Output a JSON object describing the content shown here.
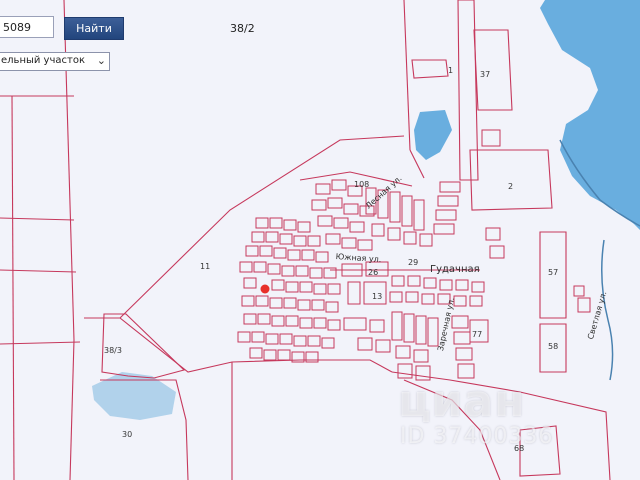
{
  "toolbar": {
    "search_value": "5089",
    "find_label": "Найти",
    "type_select_value": "ельный участок"
  },
  "map": {
    "quarter_label": "38/2",
    "quarter_left_label": "38/3",
    "parcel_numbers": [
      "37",
      "2",
      "11",
      "26",
      "29",
      "13",
      "30",
      "57",
      "58",
      "68",
      "77",
      "108",
      "1"
    ],
    "streets": [
      "Гудачная",
      "Лесная ул.",
      "Южная ул.",
      "Заречная ул.",
      "Светлая ул."
    ],
    "selected_marker_color": "#e8302a",
    "boundary_color": "#c6385c",
    "water_color": "#5aa6dc"
  },
  "watermark": {
    "brand": "циан",
    "id_text": "ID 37400336"
  }
}
